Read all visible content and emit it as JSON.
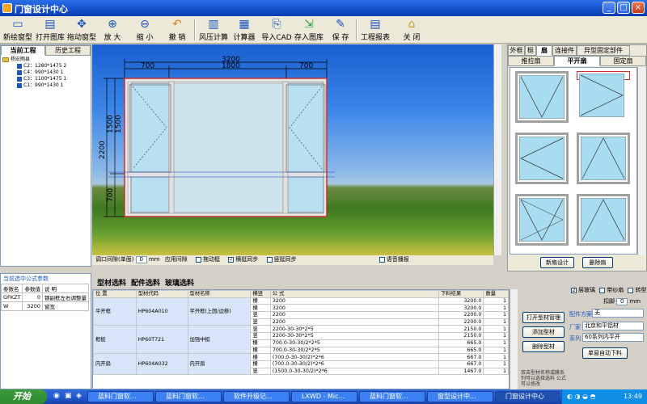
{
  "window": {
    "title": "门窗设计中心",
    "min": "_",
    "max": "□",
    "close": "×"
  },
  "toolbar": [
    {
      "label": "新绘窗型",
      "icon": "new-window-icon"
    },
    {
      "label": "打开图库",
      "icon": "open-library-icon"
    },
    {
      "label": "拖动窗型",
      "icon": "drag-window-icon"
    },
    {
      "label": "放 大",
      "icon": "zoom-in-icon"
    },
    {
      "label": "缩 小",
      "icon": "zoom-out-icon"
    },
    {
      "label": "撤 销",
      "icon": "undo-icon"
    },
    {
      "label": "风压计算",
      "icon": "wind-pressure-icon"
    },
    {
      "label": "计算器",
      "icon": "calculator-icon"
    },
    {
      "label": "导入CAD",
      "icon": "import-cad-icon"
    },
    {
      "label": "存入图库",
      "icon": "save-library-icon"
    },
    {
      "label": "保 存",
      "icon": "save-icon"
    },
    {
      "label": "工程报表",
      "icon": "report-icon"
    },
    {
      "label": "关 闭",
      "icon": "close-icon"
    }
  ],
  "left": {
    "tabs": [
      "当前工程",
      "历史工程"
    ],
    "tree_root": "杨宏雨县",
    "tree_items": [
      "C2：1280*1475 2",
      "C4：990*1430 1",
      "C3：1100*1475 1",
      "C1：990*1430 1"
    ]
  },
  "drawing": {
    "dim_top": "3200",
    "dim_left_top": "700",
    "dim_mid": "1800",
    "dim_right_top": "700",
    "dim_height": "2200",
    "dim_upper_a": "1500",
    "dim_upper_b": "1500",
    "dim_lower": "700"
  },
  "options_bar": {
    "gap_label": "调口间隙(单面)",
    "gap_value": "0",
    "gap_unit": "mm",
    "apply_gap": "应用间隙",
    "drag_frame": "拖动梃",
    "horiz_sync": "横挺同步",
    "vert_sync": "竖挺同步",
    "voice": "语音播报"
  },
  "right": {
    "tabs": [
      "外框",
      "梃",
      "扇",
      "连接件",
      "异型固定部件"
    ],
    "subtabs": [
      "推拉扇",
      "平开扇",
      "固定扇"
    ],
    "new_sash": "新扇设计",
    "delete_sash": "删除扇"
  },
  "params": {
    "title": "当前选中公式参数",
    "headers": [
      "参数名",
      "参数值",
      "说 明"
    ],
    "rows": [
      [
        "GFKZT",
        "0",
        "钢副框左右调整量"
      ],
      [
        "W",
        "3200",
        "窗宽"
      ]
    ]
  },
  "bottom_tabs": [
    "型材选料",
    "配件选料",
    "玻璃选料"
  ],
  "grid": {
    "headers": [
      "位 置",
      "型材代码",
      "型材名称",
      "横竖",
      "公 式",
      "下料结果",
      "数量"
    ],
    "groups": [
      {
        "position": "平开框",
        "code": "HP604A010",
        "name": "平开框(上固/边移)",
        "rows": [
          [
            "横",
            "3200",
            "3200.0",
            "1"
          ],
          [
            "横",
            "3200",
            "3200.0",
            "1"
          ],
          [
            "竖",
            "2200",
            "2200.0",
            "1"
          ],
          [
            "竖",
            "2200",
            "2200.0",
            "1"
          ]
        ]
      },
      {
        "position": "框梃",
        "code": "HP60T721",
        "name": "加强中梃",
        "rows": [
          [
            "竖",
            "2200-30-30*2*5",
            "2150.0",
            "1"
          ],
          [
            "竖",
            "2200-30-30*2*5",
            "2150.0",
            "1"
          ],
          [
            "横",
            "700.0-30-30/2*2*5",
            "665.0",
            "1"
          ],
          [
            "横",
            "700.0-30-30/2*2*5",
            "665.0",
            "1"
          ]
        ]
      },
      {
        "position": "内开扇",
        "code": "HP604A032",
        "name": "内开扇",
        "rows": [
          [
            "横",
            "(700.0-30-30/2)*2*6",
            "667.0",
            "1"
          ],
          [
            "横",
            "(700.0-30-30/2)*2*6",
            "667.0",
            "1"
          ],
          [
            "竖",
            "(1500.0-30-30/2)*2*6",
            "1467.0",
            "1"
          ]
        ]
      }
    ]
  },
  "mid_buttons": [
    "打开型材管理",
    "添加型材",
    "删除型材"
  ],
  "mid_note": "双击型材名称或膜系列可以选择选料 公式可以修改",
  "right_opts": {
    "glass": "层玻璃",
    "screen": "带纱扇",
    "special": "转型",
    "handle_label": "扣脚",
    "handle_value": "0",
    "handle_unit": "mm",
    "scheme_label": "配件方案",
    "scheme_value": "无",
    "vendor_label": "厂家",
    "vendor_value": "北京和平铝材",
    "series_label": "系列",
    "series_value": "60系列内平开",
    "auto_button": "单窗自动下料"
  },
  "taskbar": {
    "start": "开始",
    "tasks": [
      "蓝料门窗软...",
      "蓝料门窗软...",
      "软件升级记...",
      "LXWD - Mic...",
      "蓝料门窗软...",
      "窗型设计中...",
      "门窗设计中心"
    ],
    "clock": "13:49"
  },
  "colors": {
    "accent": "#245ad0",
    "frame": "#c8c8c8",
    "glass": "#b8e0f0",
    "selected": "#c83030"
  }
}
